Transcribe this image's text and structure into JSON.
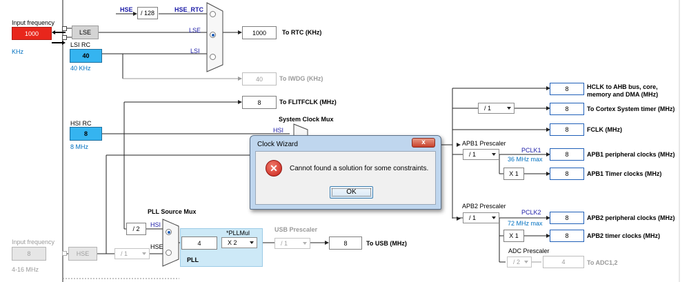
{
  "colors": {
    "accent_blue": "#1f5fb8",
    "source_cyan": "#35b4f0",
    "source_red": "#e8261c",
    "pll_panel": "#cde9f7",
    "dialog_frame": "#bfd6ee"
  },
  "hse_rtc": {
    "src_label": "HSE",
    "divider": "/ 128",
    "out_label": "HSE_RTC"
  },
  "input_freq": {
    "label": "Input frequency",
    "value": "1000",
    "unit": "KHz"
  },
  "lse": {
    "label": "LSE",
    "mux_label": "LSE"
  },
  "lsi": {
    "title": "LSI RC",
    "value": "40",
    "freq": "40 KHz",
    "mux_label": "LSI"
  },
  "rtc": {
    "value": "1000",
    "label": "To RTC (KHz)"
  },
  "iwdg": {
    "value": "40",
    "label": "To IWDG (KHz)"
  },
  "flitf": {
    "value": "8",
    "label": "To FLITFCLK (MHz)"
  },
  "hsi": {
    "title": "HSI RC",
    "value": "8",
    "freq": "8 MHz"
  },
  "sysclk_mux": {
    "title": "System Clock Mux",
    "hsi_label": "HSI"
  },
  "outputs": {
    "hclk": {
      "value": "8",
      "label": "HCLK to AHB bus, core, memory and DMA (MHz)"
    },
    "cortex_div": "/ 1",
    "cortex": {
      "value": "8",
      "label": "To Cortex System timer (MHz)"
    },
    "fclk": {
      "value": "8",
      "label": "FCLK (MHz)"
    }
  },
  "apb1": {
    "prescaler_label": "APB1 Prescaler",
    "prescaler": "/ 1",
    "pclk_label": "PCLK1",
    "max_label": "36 MHz max",
    "mult": "X 1",
    "periph_value": "8",
    "periph_label": "APB1 peripheral clocks (MHz)",
    "timer_value": "8",
    "timer_label": "APB1 Timer clocks (MHz)"
  },
  "apb2": {
    "prescaler_label": "APB2 Prescaler",
    "prescaler": "/ 1",
    "pclk_label": "PCLK2",
    "max_label": "72 MHz max",
    "mult": "X 1",
    "periph_value": "8",
    "periph_label": "APB2 peripheral clocks (MHz)",
    "timer_value": "8",
    "timer_label": "APB2 timer clocks (MHz)"
  },
  "adc": {
    "prescaler_label": "ADC Prescaler",
    "prescaler": "/ 2",
    "value": "4",
    "label": "To ADC1,2"
  },
  "pll_src": {
    "title": "PLL Source Mux",
    "hsi_div": "/ 2",
    "hsi_label": "HSI",
    "hse_label": "HSE"
  },
  "pll": {
    "label": "PLL",
    "value": "4",
    "mul_label": "*PLLMul",
    "mul": "X 2"
  },
  "usb": {
    "prescaler_label": "USB Prescaler",
    "prescaler": "/ 1",
    "value": "8",
    "label": "To USB (MHz)"
  },
  "hse_input": {
    "label": "Input frequency",
    "value": "8",
    "range": "4-16 MHz",
    "name": "HSE",
    "prediv": "/ 1"
  },
  "dialog": {
    "title": "Clock Wizard",
    "close": "x",
    "message": "Cannot found a solution for some constraints.",
    "ok": "OK",
    "icon_glyph": "✕"
  }
}
